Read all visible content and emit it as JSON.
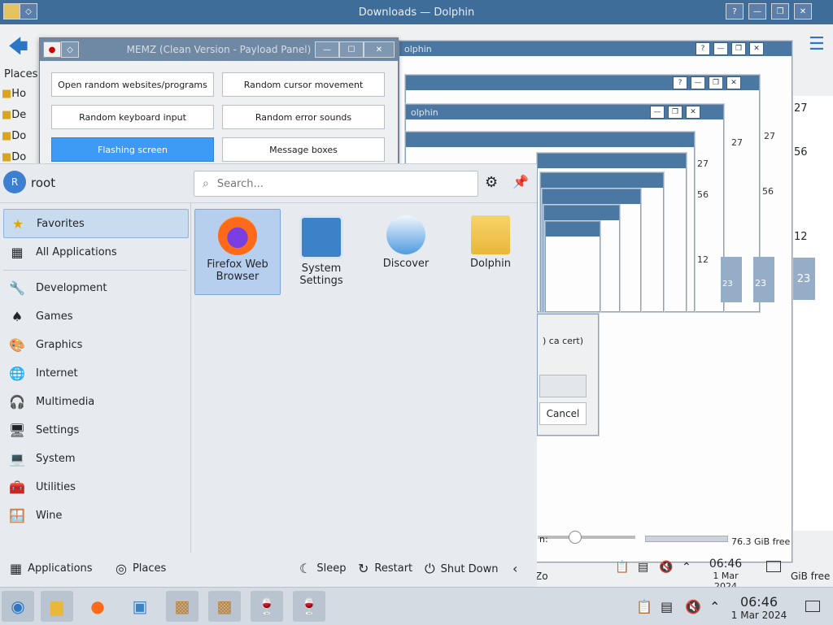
{
  "dolphin": {
    "title": "Downloads — Dolphin",
    "breadcrumb": "Downloads",
    "places_label": "Places",
    "places": [
      "Ho",
      "De",
      "Do",
      "Do"
    ],
    "free_space": "76.3 GiB free",
    "free_space_right": "GiB free",
    "zoom_label": "n:",
    "cancel_label": "Cancel",
    "cert_text": ") ca cert)",
    "zo_text": "Zo"
  },
  "ghosts": {
    "title": "olphin",
    "times": [
      "27",
      "56",
      "12",
      "23"
    ]
  },
  "memz": {
    "title": "MEMZ (Clean Version - Payload Panel)",
    "buttons": [
      "Open random websites/programs",
      "Random cursor movement",
      "Random keyboard input",
      "Random error sounds",
      "Flashing screen",
      "Message boxes"
    ]
  },
  "launcher": {
    "user": "root",
    "avatar_letter": "R",
    "search_placeholder": "Search...",
    "categories": [
      {
        "label": "Favorites",
        "icon": "star-icon"
      },
      {
        "label": "All Applications",
        "icon": "grid-icon"
      },
      {
        "label": "Development",
        "icon": "tools-icon"
      },
      {
        "label": "Games",
        "icon": "game-icon"
      },
      {
        "label": "Graphics",
        "icon": "palette-icon"
      },
      {
        "label": "Internet",
        "icon": "globe-icon"
      },
      {
        "label": "Multimedia",
        "icon": "media-icon"
      },
      {
        "label": "Settings",
        "icon": "settings-icon"
      },
      {
        "label": "System",
        "icon": "system-icon"
      },
      {
        "label": "Utilities",
        "icon": "utilities-icon"
      },
      {
        "label": "Wine",
        "icon": "wine-icon"
      }
    ],
    "apps": [
      {
        "label": "Firefox Web Browser",
        "icon": "firefox-icon"
      },
      {
        "label": "System Settings",
        "icon": "system-settings-icon"
      },
      {
        "label": "Discover",
        "icon": "discover-icon"
      },
      {
        "label": "Dolphin",
        "icon": "folder-icon"
      }
    ],
    "footer": {
      "applications": "Applications",
      "places": "Places",
      "sleep": "Sleep",
      "restart": "Restart",
      "shutdown": "Shut Down"
    }
  },
  "clock": {
    "time": "06:46",
    "date": "1 Mar 2024"
  },
  "colors": {
    "accent": "#3d9bf5",
    "titlebar": "#45709c"
  }
}
